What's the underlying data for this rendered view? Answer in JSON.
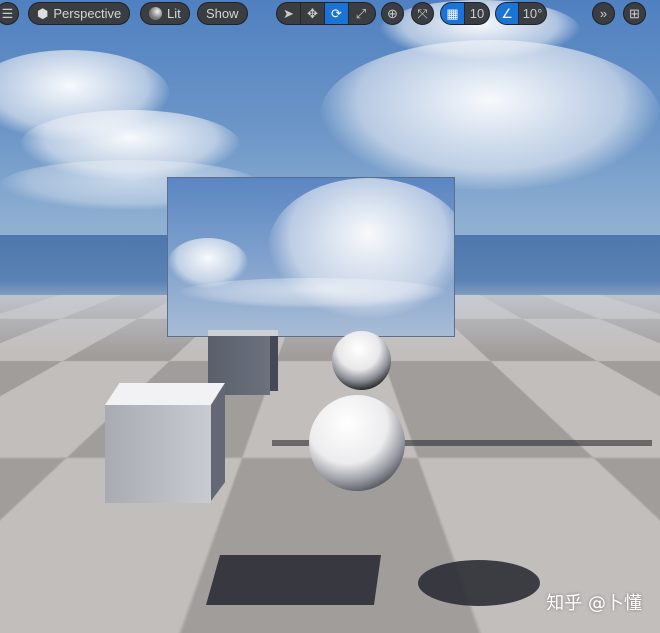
{
  "toolbar": {
    "menu_icon": "hamburger-icon",
    "view_mode": "Perspective",
    "lighting": "Lit",
    "show": "Show",
    "transform_tools": [
      "select",
      "translate",
      "rotate",
      "scale"
    ],
    "active_tool": "rotate",
    "grid_snap_value": "10",
    "rotation_snap_value": "10°",
    "colors": {
      "active": "#1a73d6",
      "pill": "#3a3d42"
    }
  },
  "watermark": "知乎 @卜懂"
}
